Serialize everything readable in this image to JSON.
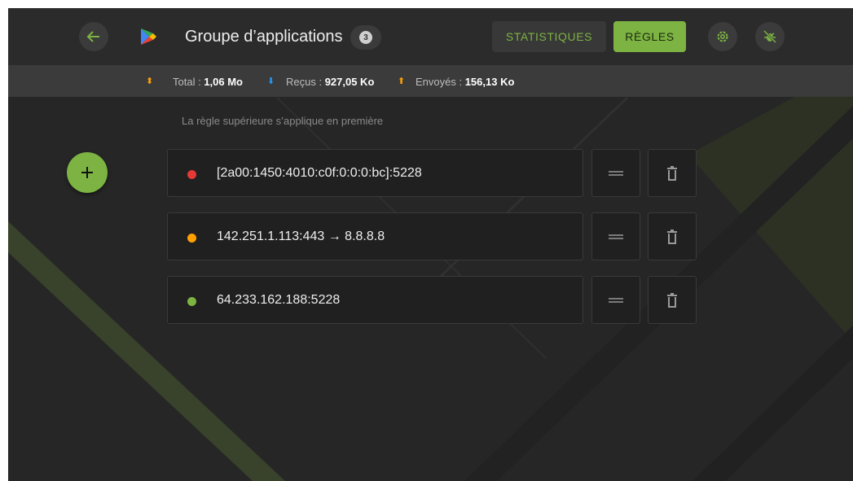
{
  "header": {
    "title": "Groupe d’applications",
    "app_count": "3",
    "tab_statistics": "STATISTIQUES",
    "tab_rules": "RÈGLES",
    "accent_color": "#7cb342"
  },
  "stats": {
    "total_label": "Total : ",
    "total_value": "1,06 Mo",
    "received_label": "Reçus : ",
    "received_value": "927,05 Ko",
    "sent_label": "Envoyés : ",
    "sent_value": "156,13 Ko"
  },
  "rules": {
    "hint": "La règle supérieure s’applique en première",
    "items": [
      {
        "target": "[2a00:1450:4010:c0f:0:0:0:bc]:5228",
        "status_color": "#e53935"
      },
      {
        "target": "142.251.1.113:443 → 8.8.8.8",
        "status_color": "#ffa000"
      },
      {
        "target": "64.233.162.188:5228",
        "status_color": "#7cb342"
      }
    ]
  },
  "icons": {
    "back": "arrow-left-icon",
    "app": "google-play-icon",
    "settings": "gear-icon",
    "debug": "bug-off-icon",
    "add": "plus-icon",
    "drag": "drag-handle-icon",
    "delete": "trash-icon"
  }
}
